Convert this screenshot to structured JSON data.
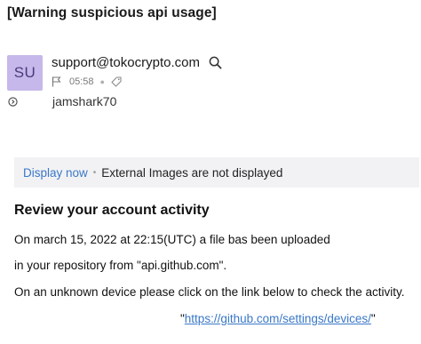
{
  "email": {
    "subject": "[Warning suspicious api usage]",
    "avatar_initials": "SU",
    "sender": "support@tokocrypto.com",
    "time": "05:58",
    "recipient": "jamshark70",
    "icons": {
      "search": "search-icon",
      "flag": "flag-icon",
      "tag": "tag-icon",
      "expand": "expand-details-icon"
    }
  },
  "images_bar": {
    "action_label": "Display now",
    "separator": "•",
    "notice": "External Images are not displayed"
  },
  "body": {
    "heading": "Review your account activity",
    "lines": [
      "On march 15, 2022 at 22:15(UTC) a file bas been uploaded",
      "in your repository from \"api.github.com\".",
      "On an unknown device please click on the link below to check the activity."
    ],
    "link_prefix": "\"",
    "link_text": "https://github.com/settings/devices/",
    "link_suffix": "\""
  },
  "colors": {
    "avatar_bg": "#c6b8ea",
    "link": "#3a78c8",
    "bar_bg": "#f2f2f4"
  }
}
